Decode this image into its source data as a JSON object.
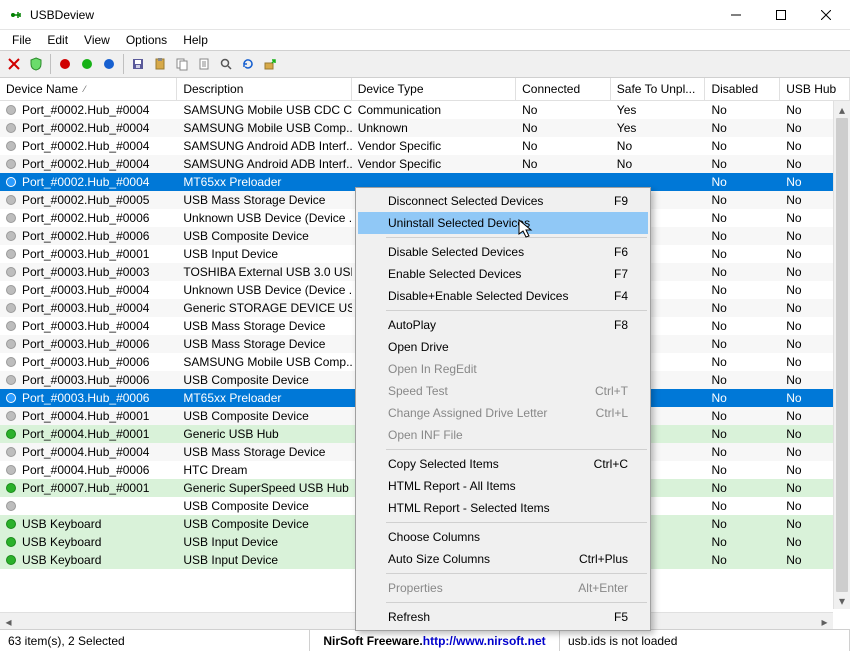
{
  "window": {
    "title": "USBDeview"
  },
  "menubar": [
    "File",
    "Edit",
    "View",
    "Options",
    "Help"
  ],
  "toolbar_icons": [
    "close-red-x",
    "shield",
    "sep",
    "dot-red",
    "dot-green",
    "dot-blue",
    "sep",
    "save",
    "clipboard",
    "doc-copy",
    "doc",
    "find",
    "refresh",
    "export"
  ],
  "columns": [
    "Device Name",
    "Description",
    "Device Type",
    "Connected",
    "Safe To Unpl...",
    "Disabled",
    "USB Hub"
  ],
  "rows": [
    {
      "status": "off",
      "name": "Port_#0002.Hub_#0004",
      "desc": "SAMSUNG Mobile USB CDC C...",
      "type": "Communication",
      "connected": "No",
      "safe": "Yes",
      "disabled": "No",
      "hub": "No"
    },
    {
      "status": "off",
      "name": "Port_#0002.Hub_#0004",
      "desc": "SAMSUNG Mobile USB Comp...",
      "type": "Unknown",
      "connected": "No",
      "safe": "Yes",
      "disabled": "No",
      "hub": "No"
    },
    {
      "status": "off",
      "name": "Port_#0002.Hub_#0004",
      "desc": "SAMSUNG Android ADB Interf...",
      "type": "Vendor Specific",
      "connected": "No",
      "safe": "No",
      "disabled": "No",
      "hub": "No"
    },
    {
      "status": "off",
      "name": "Port_#0002.Hub_#0004",
      "desc": "SAMSUNG Android ADB Interf...",
      "type": "Vendor Specific",
      "connected": "No",
      "safe": "No",
      "disabled": "No",
      "hub": "No"
    },
    {
      "status": "sel",
      "name": "Port_#0002.Hub_#0004",
      "desc": "MT65xx Preloader",
      "type": "",
      "connected": "",
      "safe": "",
      "disabled": "No",
      "hub": "No"
    },
    {
      "status": "off",
      "name": "Port_#0002.Hub_#0005",
      "desc": "USB Mass Storage Device",
      "type": "",
      "connected": "",
      "safe": "",
      "disabled": "No",
      "hub": "No"
    },
    {
      "status": "off",
      "name": "Port_#0002.Hub_#0006",
      "desc": "Unknown USB Device (Device ...",
      "type": "",
      "connected": "",
      "safe": "",
      "disabled": "No",
      "hub": "No"
    },
    {
      "status": "off",
      "name": "Port_#0002.Hub_#0006",
      "desc": "USB Composite Device",
      "type": "",
      "connected": "",
      "safe": "",
      "disabled": "No",
      "hub": "No"
    },
    {
      "status": "off",
      "name": "Port_#0003.Hub_#0001",
      "desc": "USB Input Device",
      "type": "",
      "connected": "",
      "safe": "",
      "disabled": "No",
      "hub": "No"
    },
    {
      "status": "off",
      "name": "Port_#0003.Hub_#0003",
      "desc": "TOSHIBA External USB 3.0 USB...",
      "type": "",
      "connected": "",
      "safe": "",
      "disabled": "No",
      "hub": "No"
    },
    {
      "status": "off",
      "name": "Port_#0003.Hub_#0004",
      "desc": "Unknown USB Device (Device ...",
      "type": "",
      "connected": "",
      "safe": "",
      "disabled": "No",
      "hub": "No"
    },
    {
      "status": "off",
      "name": "Port_#0003.Hub_#0004",
      "desc": "Generic STORAGE DEVICE USB...",
      "type": "",
      "connected": "",
      "safe": "",
      "disabled": "No",
      "hub": "No"
    },
    {
      "status": "off",
      "name": "Port_#0003.Hub_#0004",
      "desc": "USB Mass Storage Device",
      "type": "",
      "connected": "",
      "safe": "",
      "disabled": "No",
      "hub": "No"
    },
    {
      "status": "off",
      "name": "Port_#0003.Hub_#0006",
      "desc": "USB Mass Storage Device",
      "type": "",
      "connected": "",
      "safe": "",
      "disabled": "No",
      "hub": "No"
    },
    {
      "status": "off",
      "name": "Port_#0003.Hub_#0006",
      "desc": "SAMSUNG Mobile USB Comp...",
      "type": "",
      "connected": "",
      "safe": "",
      "disabled": "No",
      "hub": "No"
    },
    {
      "status": "off",
      "name": "Port_#0003.Hub_#0006",
      "desc": "USB Composite Device",
      "type": "",
      "connected": "",
      "safe": "",
      "disabled": "No",
      "hub": "No"
    },
    {
      "status": "sel",
      "name": "Port_#0003.Hub_#0006",
      "desc": "MT65xx Preloader",
      "type": "",
      "connected": "",
      "safe": "",
      "disabled": "No",
      "hub": "No"
    },
    {
      "status": "off",
      "name": "Port_#0004.Hub_#0001",
      "desc": "USB Composite Device",
      "type": "",
      "connected": "",
      "safe": "",
      "disabled": "No",
      "hub": "No"
    },
    {
      "status": "on",
      "name": "Port_#0004.Hub_#0001",
      "desc": "Generic USB Hub",
      "type": "",
      "connected": "",
      "safe": "",
      "disabled": "No",
      "hub": "No"
    },
    {
      "status": "off",
      "name": "Port_#0004.Hub_#0004",
      "desc": "USB Mass Storage Device",
      "type": "",
      "connected": "",
      "safe": "",
      "disabled": "No",
      "hub": "No"
    },
    {
      "status": "off",
      "name": "Port_#0004.Hub_#0006",
      "desc": "HTC Dream",
      "type": "",
      "connected": "",
      "safe": "",
      "disabled": "No",
      "hub": "No"
    },
    {
      "status": "on",
      "name": "Port_#0007.Hub_#0001",
      "desc": "Generic SuperSpeed USB Hub",
      "type": "",
      "connected": "",
      "safe": "",
      "disabled": "No",
      "hub": "No"
    },
    {
      "status": "off",
      "name": "",
      "desc": "USB Composite Device",
      "type": "",
      "connected": "",
      "safe": "",
      "disabled": "No",
      "hub": "No"
    },
    {
      "status": "on",
      "name": "USB Keyboard",
      "desc": "USB Composite Device",
      "type": "",
      "connected": "",
      "safe": "",
      "disabled": "No",
      "hub": "No"
    },
    {
      "status": "on",
      "name": "USB Keyboard",
      "desc": "USB Input Device",
      "type": "",
      "connected": "",
      "safe": "",
      "disabled": "No",
      "hub": "No"
    },
    {
      "status": "on",
      "name": "USB Keyboard",
      "desc": "USB Input Device",
      "type": "",
      "connected": "",
      "safe": "",
      "disabled": "No",
      "hub": "No"
    }
  ],
  "context_menu": [
    {
      "label": "Disconnect Selected Devices",
      "shortcut": "F9"
    },
    {
      "label": "Uninstall Selected Devices",
      "shortcut": "",
      "hover": true
    },
    {
      "sep": true
    },
    {
      "label": "Disable Selected Devices",
      "shortcut": "F6"
    },
    {
      "label": "Enable Selected Devices",
      "shortcut": "F7"
    },
    {
      "label": "Disable+Enable Selected Devices",
      "shortcut": "F4"
    },
    {
      "sep": true
    },
    {
      "label": "AutoPlay",
      "shortcut": "F8"
    },
    {
      "label": "Open Drive",
      "shortcut": ""
    },
    {
      "label": "Open In RegEdit",
      "shortcut": "",
      "disabled": true
    },
    {
      "label": "Speed Test",
      "shortcut": "Ctrl+T",
      "disabled": true
    },
    {
      "label": "Change Assigned Drive Letter",
      "shortcut": "Ctrl+L",
      "disabled": true
    },
    {
      "label": "Open INF File",
      "shortcut": "",
      "disabled": true
    },
    {
      "sep": true
    },
    {
      "label": "Copy Selected Items",
      "shortcut": "Ctrl+C"
    },
    {
      "label": "HTML Report - All Items",
      "shortcut": ""
    },
    {
      "label": "HTML Report - Selected Items",
      "shortcut": ""
    },
    {
      "sep": true
    },
    {
      "label": "Choose Columns",
      "shortcut": ""
    },
    {
      "label": "Auto Size Columns",
      "shortcut": "Ctrl+Plus"
    },
    {
      "sep": true
    },
    {
      "label": "Properties",
      "shortcut": "Alt+Enter",
      "disabled": true
    },
    {
      "sep": true
    },
    {
      "label": "Refresh",
      "shortcut": "F5"
    }
  ],
  "statusbar": {
    "left": "63 item(s), 2 Selected",
    "brand": "NirSoft Freeware. ",
    "link": "http://www.nirsoft.net",
    "right": "usb.ids is not loaded"
  }
}
